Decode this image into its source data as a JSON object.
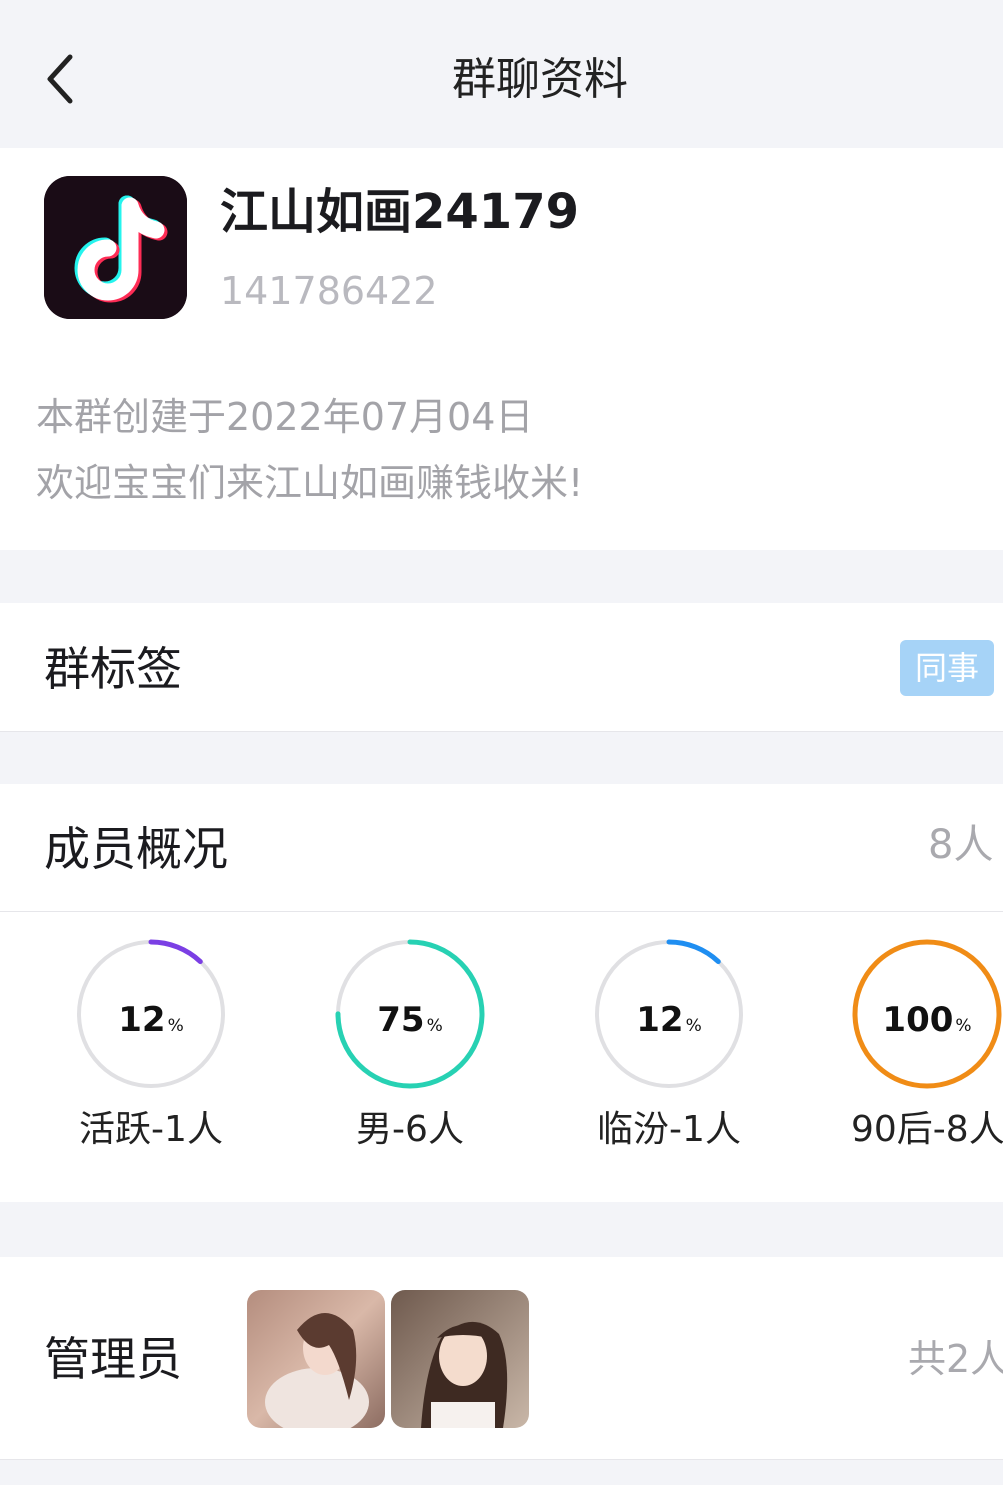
{
  "header": {
    "title": "群聊资料"
  },
  "group": {
    "name": "江山如画24179",
    "id": "141786422",
    "created": "本群创建于2022年07月04日",
    "description": "欢迎宝宝们来江山如画赚钱收米!"
  },
  "tags": {
    "label": "群标签",
    "badge": "同事"
  },
  "members": {
    "label": "成员概况",
    "count": "8人",
    "stats": [
      {
        "value": "12",
        "unit": "%",
        "fraction": 0.12,
        "label": "活跃-1人",
        "color": "#7b3fe4"
      },
      {
        "value": "75",
        "unit": "%",
        "fraction": 0.75,
        "label": "男-6人",
        "color": "#27d1b3"
      },
      {
        "value": "12",
        "unit": "%",
        "fraction": 0.12,
        "label": "临汾-1人",
        "color": "#1f8ef1"
      },
      {
        "value": "100",
        "unit": "%",
        "fraction": 1.0,
        "label": "90后-8人",
        "color": "#f08c16"
      }
    ]
  },
  "admins": {
    "label": "管理员",
    "count": "共2人"
  }
}
